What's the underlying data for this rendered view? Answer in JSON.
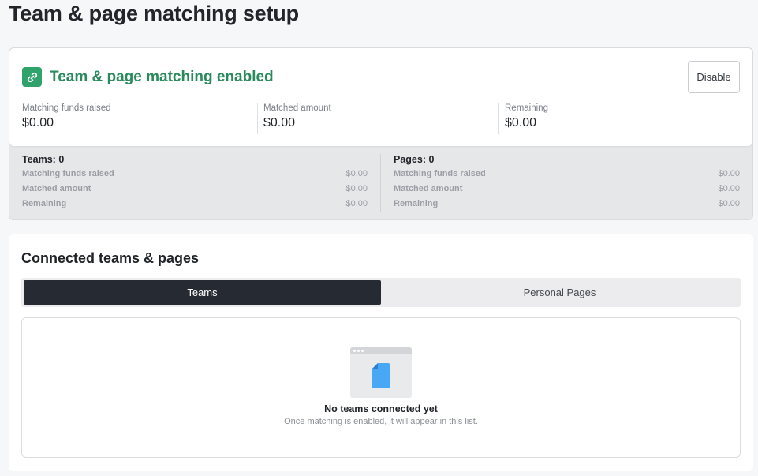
{
  "page": {
    "title": "Team & page matching setup"
  },
  "status": {
    "title": "Team & page matching enabled",
    "icon": "link-icon",
    "accent_color": "#2fa36b",
    "disable_label": "Disable",
    "metrics": [
      {
        "label": "Matching funds raised",
        "value": "$0.00"
      },
      {
        "label": "Matched amount",
        "value": "$0.00"
      },
      {
        "label": "Remaining",
        "value": "$0.00"
      }
    ]
  },
  "summary": {
    "teams": {
      "heading": "Teams: 0",
      "rows": [
        {
          "label": "Matching funds raised",
          "value": "$0.00"
        },
        {
          "label": "Matched amount",
          "value": "$0.00"
        },
        {
          "label": "Remaining",
          "value": "$0.00"
        }
      ]
    },
    "pages": {
      "heading": "Pages: 0",
      "rows": [
        {
          "label": "Matching funds raised",
          "value": "$0.00"
        },
        {
          "label": "Matched amount",
          "value": "$0.00"
        },
        {
          "label": "Remaining",
          "value": "$0.00"
        }
      ]
    }
  },
  "connected": {
    "title": "Connected teams & pages",
    "tabs": [
      {
        "label": "Teams",
        "active": true
      },
      {
        "label": "Personal Pages",
        "active": false
      }
    ],
    "empty": {
      "icon": "document-icon",
      "title": "No teams connected yet",
      "subtitle": "Once matching is enabled, it will appear in this list."
    }
  }
}
